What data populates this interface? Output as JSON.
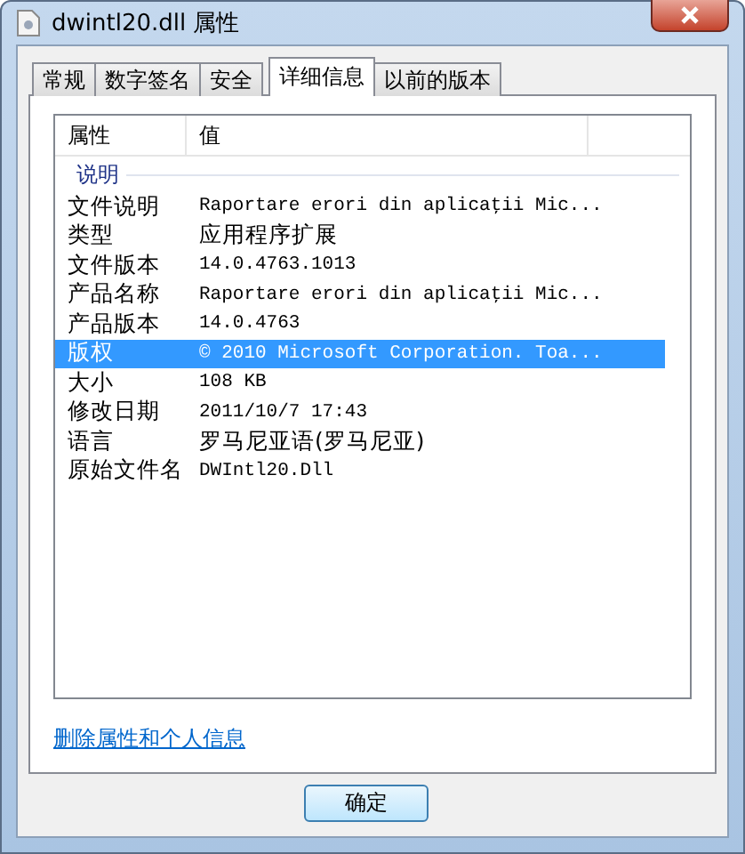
{
  "window": {
    "title": "dwintl20.dll 属性"
  },
  "tabs": [
    {
      "label": "常规",
      "selected": false
    },
    {
      "label": "数字签名",
      "selected": false
    },
    {
      "label": "安全",
      "selected": false
    },
    {
      "label": "详细信息",
      "selected": true
    },
    {
      "label": "以前的版本",
      "selected": false
    }
  ],
  "table": {
    "columns": [
      "属性",
      "值"
    ],
    "group": "说明",
    "rows": [
      {
        "name": "文件说明",
        "value": "Raportare erori din aplicaţii Mic...",
        "selected": false
      },
      {
        "name": "类型",
        "value": "应用程序扩展",
        "selected": false
      },
      {
        "name": "文件版本",
        "value": "14.0.4763.1013",
        "selected": false
      },
      {
        "name": "产品名称",
        "value": "Raportare erori din aplicaţii Mic...",
        "selected": false
      },
      {
        "name": "产品版本",
        "value": "14.0.4763",
        "selected": false
      },
      {
        "name": "版权",
        "value": "© 2010 Microsoft Corporation. Toa...",
        "selected": true
      },
      {
        "name": "大小",
        "value": "108 KB",
        "selected": false
      },
      {
        "name": "修改日期",
        "value": "2011/10/7 17:43",
        "selected": false
      },
      {
        "name": "语言",
        "value": "罗马尼亚语(罗马尼亚)",
        "selected": false
      },
      {
        "name": "原始文件名",
        "value": "DWIntl20.Dll",
        "selected": false
      }
    ]
  },
  "link": "删除属性和个人信息",
  "buttons": [
    "确定"
  ]
}
